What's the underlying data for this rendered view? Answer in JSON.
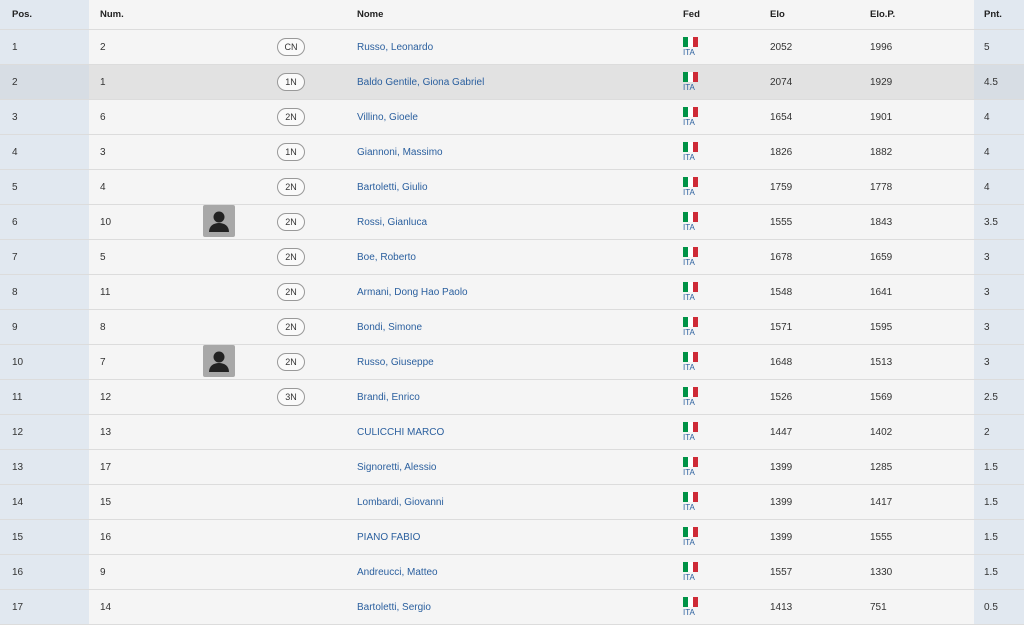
{
  "headers": {
    "pos": "Pos.",
    "num": "Num.",
    "name": "Nome",
    "fed": "Fed",
    "elo": "Elo",
    "elop": "Elo.P.",
    "pnt": "Pnt."
  },
  "colors": {
    "link": "#2a5f9e",
    "flag_green": "#009246",
    "flag_white": "#ffffff",
    "flag_red": "#ce2b37"
  },
  "rows": [
    {
      "pos": "1",
      "num": "2",
      "title": "CN",
      "photo": false,
      "name": "Russo, Leonardo",
      "fed": "ITA",
      "elo": "2052",
      "elop": "1996",
      "pnt": "5"
    },
    {
      "pos": "2",
      "num": "1",
      "title": "1N",
      "photo": false,
      "name": "Baldo Gentile, Giona Gabriel",
      "fed": "ITA",
      "elo": "2074",
      "elop": "1929",
      "pnt": "4.5"
    },
    {
      "pos": "3",
      "num": "6",
      "title": "2N",
      "photo": false,
      "name": "Villino, Gioele",
      "fed": "ITA",
      "elo": "1654",
      "elop": "1901",
      "pnt": "4"
    },
    {
      "pos": "4",
      "num": "3",
      "title": "1N",
      "photo": false,
      "name": "Giannoni, Massimo",
      "fed": "ITA",
      "elo": "1826",
      "elop": "1882",
      "pnt": "4"
    },
    {
      "pos": "5",
      "num": "4",
      "title": "2N",
      "photo": false,
      "name": "Bartoletti, Giulio",
      "fed": "ITA",
      "elo": "1759",
      "elop": "1778",
      "pnt": "4"
    },
    {
      "pos": "6",
      "num": "10",
      "title": "2N",
      "photo": true,
      "name": "Rossi, Gianluca",
      "fed": "ITA",
      "elo": "1555",
      "elop": "1843",
      "pnt": "3.5"
    },
    {
      "pos": "7",
      "num": "5",
      "title": "2N",
      "photo": false,
      "name": "Boe, Roberto",
      "fed": "ITA",
      "elo": "1678",
      "elop": "1659",
      "pnt": "3"
    },
    {
      "pos": "8",
      "num": "11",
      "title": "2N",
      "photo": false,
      "name": "Armani, Dong Hao Paolo",
      "fed": "ITA",
      "elo": "1548",
      "elop": "1641",
      "pnt": "3"
    },
    {
      "pos": "9",
      "num": "8",
      "title": "2N",
      "photo": false,
      "name": "Bondi, Simone",
      "fed": "ITA",
      "elo": "1571",
      "elop": "1595",
      "pnt": "3"
    },
    {
      "pos": "10",
      "num": "7",
      "title": "2N",
      "photo": true,
      "name": "Russo, Giuseppe",
      "fed": "ITA",
      "elo": "1648",
      "elop": "1513",
      "pnt": "3"
    },
    {
      "pos": "11",
      "num": "12",
      "title": "3N",
      "photo": false,
      "name": "Brandi, Enrico",
      "fed": "ITA",
      "elo": "1526",
      "elop": "1569",
      "pnt": "2.5"
    },
    {
      "pos": "12",
      "num": "13",
      "title": "",
      "photo": false,
      "name": "CULICCHI MARCO",
      "fed": "ITA",
      "elo": "1447",
      "elop": "1402",
      "pnt": "2"
    },
    {
      "pos": "13",
      "num": "17",
      "title": "",
      "photo": false,
      "name": "Signoretti, Alessio",
      "fed": "ITA",
      "elo": "1399",
      "elop": "1285",
      "pnt": "1.5"
    },
    {
      "pos": "14",
      "num": "15",
      "title": "",
      "photo": false,
      "name": "Lombardi, Giovanni",
      "fed": "ITA",
      "elo": "1399",
      "elop": "1417",
      "pnt": "1.5"
    },
    {
      "pos": "15",
      "num": "16",
      "title": "",
      "photo": false,
      "name": "PIANO FABIO",
      "fed": "ITA",
      "elo": "1399",
      "elop": "1555",
      "pnt": "1.5"
    },
    {
      "pos": "16",
      "num": "9",
      "title": "",
      "photo": false,
      "name": "Andreucci, Matteo",
      "fed": "ITA",
      "elo": "1557",
      "elop": "1330",
      "pnt": "1.5"
    },
    {
      "pos": "17",
      "num": "14",
      "title": "",
      "photo": false,
      "name": "Bartoletti, Sergio",
      "fed": "ITA",
      "elo": "1413",
      "elop": "751",
      "pnt": "0.5"
    }
  ]
}
